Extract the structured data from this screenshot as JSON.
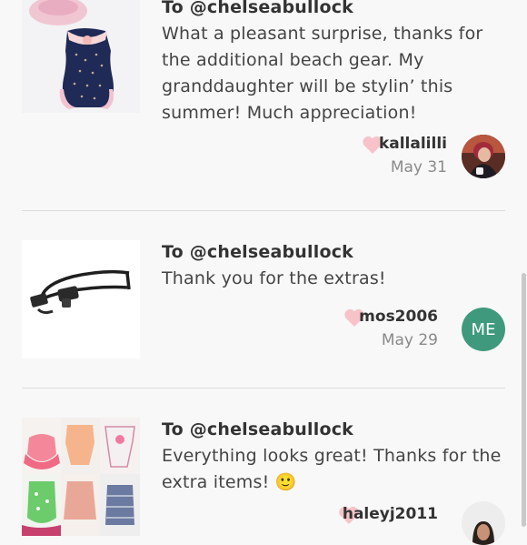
{
  "reviews": [
    {
      "to_label": "To @chelseabullock",
      "message": "What a pleasant surprise, thanks for the additional beach gear. My granddaughter will be stylin’ this summer! Much appreciation!",
      "user": "kallalilli",
      "date": "May 31",
      "thumbnail_icon": "pink-swimsuit-photo",
      "avatar_icon": "user-photo-avatar"
    },
    {
      "to_label": "To @chelseabullock",
      "message": "Thank you for the extras!",
      "user": "mos2006",
      "date": "May 29",
      "thumbnail_icon": "car-seat-adapter-photo",
      "avatar_initials": "ME",
      "avatar_color": "#3f9a7d"
    },
    {
      "to_label": "To @chelseabullock",
      "message": "Everything looks great! Thanks for the extra items! 🙂",
      "user": "haleyj2011",
      "thumbnail_icon": "baby-clothes-collage-photo",
      "avatar_icon": "user-photo-avatar"
    }
  ],
  "colors": {
    "heart": "#f7c3c8",
    "divider": "#dcdcdc",
    "background": "#f8f8f8"
  }
}
